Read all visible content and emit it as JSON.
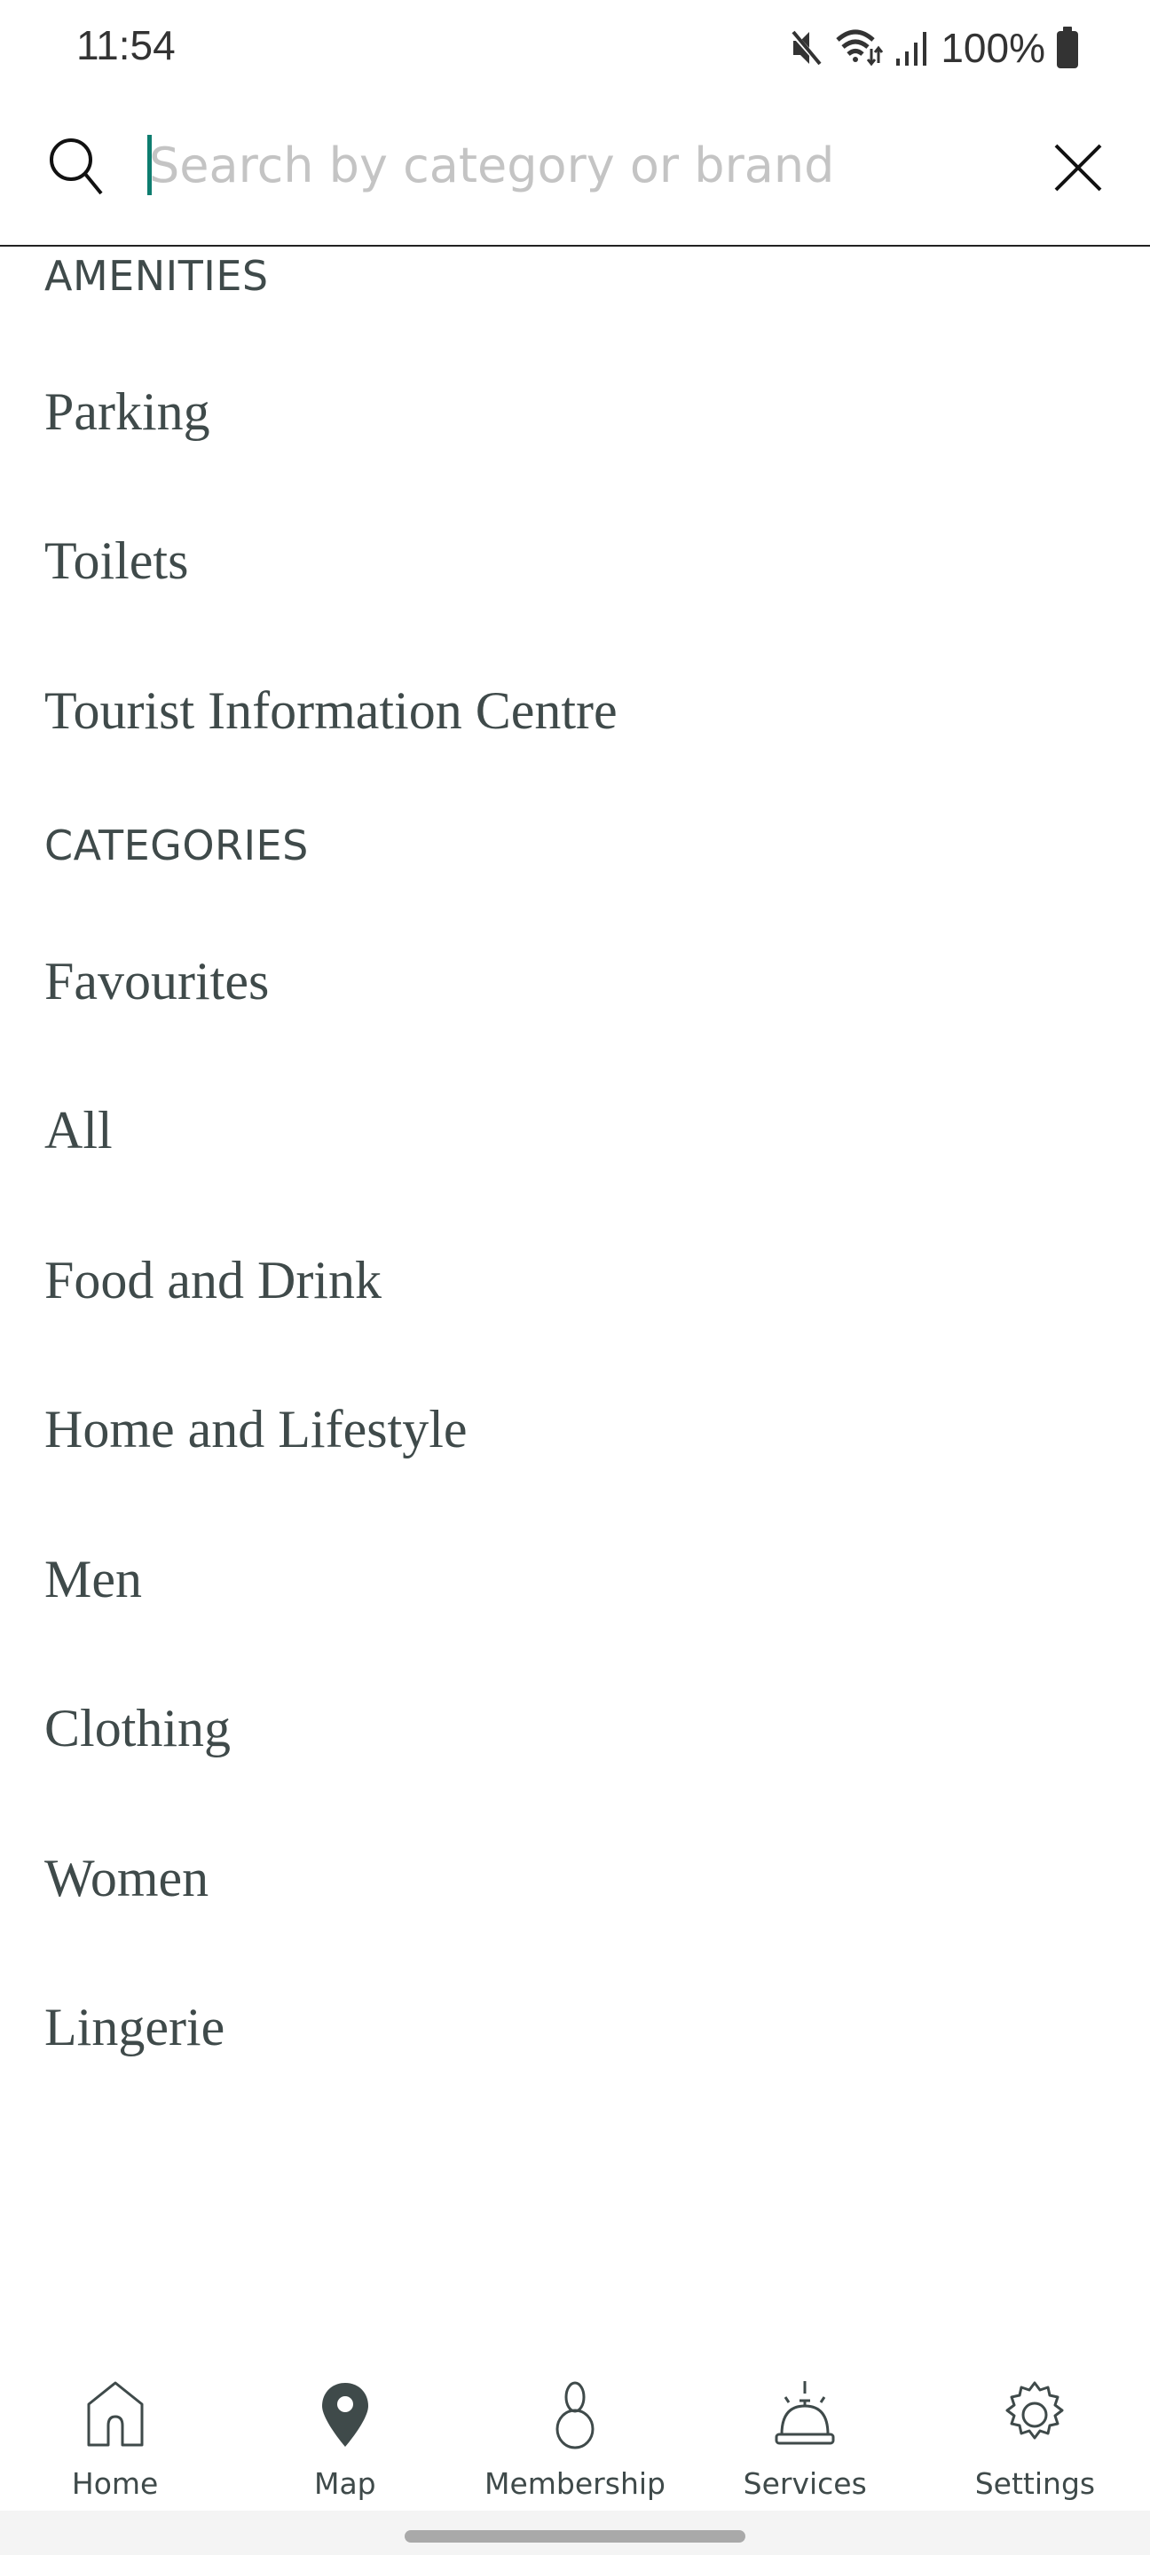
{
  "status_bar": {
    "time": "11:54",
    "battery": "100%",
    "icons": [
      "mute-icon",
      "wifi-icon",
      "signal-icon",
      "battery-icon"
    ]
  },
  "search": {
    "placeholder": "Search by category or brand",
    "value": "",
    "caret_color": "#0e7d6f"
  },
  "sections": {
    "amenities": {
      "header": "AMENITIES",
      "items": [
        "Parking",
        "Toilets",
        "Tourist Information Centre"
      ]
    },
    "categories": {
      "header": "CATEGORIES",
      "items": [
        "Favourites",
        "All",
        "Food and Drink",
        "Home and Lifestyle",
        "Men",
        "Clothing",
        "Women",
        "Lingerie"
      ]
    }
  },
  "bottom_nav": {
    "items": [
      {
        "label": "Home",
        "icon": "home-icon"
      },
      {
        "label": "Map",
        "icon": "map-pin-icon"
      },
      {
        "label": "Membership",
        "icon": "person-icon"
      },
      {
        "label": "Services",
        "icon": "service-bell-icon"
      },
      {
        "label": "Settings",
        "icon": "gear-icon"
      }
    ]
  },
  "colors": {
    "text": "#3f4a4a",
    "placeholder": "#c4c4c4",
    "accent": "#0e7d6f"
  }
}
